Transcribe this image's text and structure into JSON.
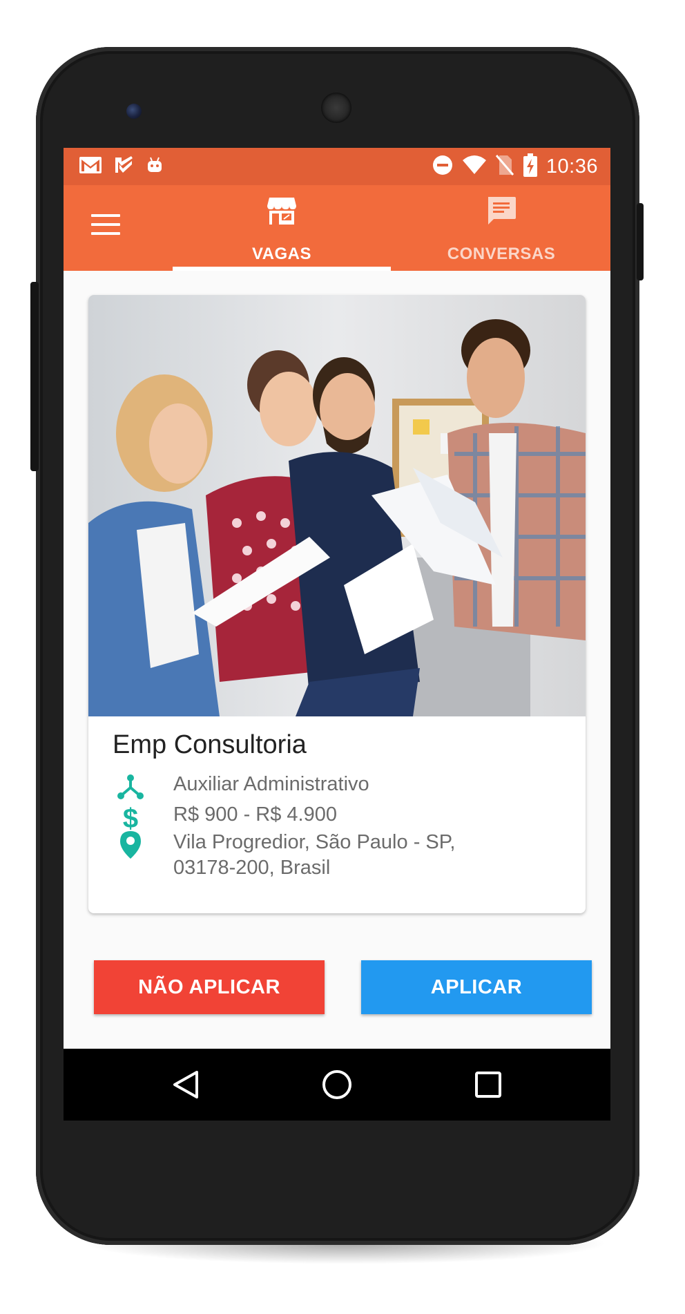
{
  "status_bar": {
    "time": "10:36",
    "icons": [
      "gmail-icon",
      "task-check-icon",
      "android-icon",
      "do-not-disturb-icon",
      "wifi-icon",
      "no-sim-icon",
      "battery-charging-icon"
    ]
  },
  "app_bar": {
    "menu_icon": "hamburger-menu-icon",
    "tabs": [
      {
        "label": "VAGAS",
        "icon": "storefront-icon",
        "active": true
      },
      {
        "label": "CONVERSAS",
        "icon": "chat-icon",
        "active": false
      }
    ],
    "colors": {
      "status": "#e15f36",
      "bar": "#f26b3c",
      "inactive_tab": "#fbd6c8"
    }
  },
  "job_card": {
    "photo_alt_icon": "team-meeting-photo",
    "company": "Emp Consultoria",
    "position": "Auxiliar Administrativo",
    "salary": "R$ 900 - R$ 4.900",
    "address_line1": "Vila Progredior, São Paulo - SP,",
    "address_line2": "03178-200, Brasil",
    "icon_color": "#19b5a0"
  },
  "actions": {
    "reject_label": "NÃO APLICAR",
    "apply_label": "APLICAR",
    "reject_color": "#f14336",
    "apply_color": "#2299f0"
  },
  "nav_bar": {
    "icons": [
      "back-icon",
      "home-icon",
      "recents-icon"
    ]
  }
}
